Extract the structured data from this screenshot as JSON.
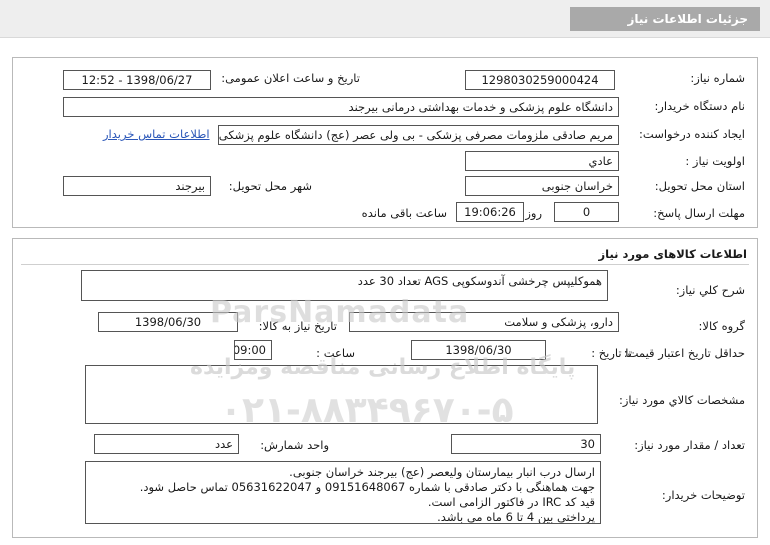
{
  "window": {
    "title": "جزئیات اطلاعات نیاز"
  },
  "info": {
    "need_number_label": "شماره نیاز:",
    "need_number": "1298030259000424",
    "announce_datetime_label": "تاریخ و ساعت اعلان عمومی:",
    "announce_datetime": "1398/06/27 - 12:52",
    "buyer_org_label": "نام دستگاه خریدار:",
    "buyer_org": "دانشگاه علوم پزشکی و خدمات بهداشتی درمانی بیرجند",
    "requester_label": "ایجاد کننده درخواست:",
    "requester": "مریم صادقی ملزومات مصرفی پزشکی - بی ولی عصر (عج) دانشگاه علوم پزشکی",
    "contact_link": "اطلاعات تماس خریدار",
    "priority_label": "اولویت نیاز :",
    "priority": "عادي",
    "province_label": "استان محل تحویل:",
    "province": "خراسان جنوبی",
    "city_label": "شهر محل تحویل:",
    "city": "بیرجند",
    "deadline_label": "مهلت ارسال پاسخ:",
    "deadline_days": "0",
    "deadline_days_suffix": "روز و",
    "deadline_time": "19:06:26",
    "deadline_remaining": "ساعت باقی مانده"
  },
  "goods": {
    "section_title": "اطلاعات کالاهای مورد نیاز",
    "general_desc_label": "شرح کلي نياز:",
    "general_desc": "هموکلیپس چرخشی آندوسکوپی AGS تعداد 30 عدد",
    "group_label": "گروه کالا:",
    "group": "دارو، پزشکی و سلامت",
    "need_date_label": "تاریخ نیاز به کالا:",
    "need_date": "1398/06/30",
    "validity_label": "حداقل تاریخ اعتبار قیمت:",
    "validity_until_label": "تا تاریخ :",
    "validity_date": "1398/06/30",
    "validity_time_label": "ساعت :",
    "validity_time": "09:00",
    "specs_label": "مشخصات کالاي مورد نياز:",
    "specs": "",
    "quantity_label": "تعداد / مقدار مورد نیاز:",
    "quantity": "30",
    "unit_label": "واحد شمارش:",
    "unit": "عدد",
    "buyer_notes_label": "توضیحات خریدار:",
    "buyer_notes": [
      "ارسال درب انبار بیمارستان ولیعصر (عج) بیرجند خراسان جنوبی.",
      "جهت هماهنگی با دکتر صادقی با شماره 09151648067 و 05631622047 تماس حاصل شود.",
      "قید کد IRC در فاکتور الزامی است.",
      "پرداختی بین 4 تا 6 ماه می باشد."
    ]
  },
  "watermark": {
    "line1": "پایگاه اطلاع رسانی مناقصه ومزایده",
    "line2": "۰۲۱-۸۸۳۴۹۶۷۰-۵",
    "brand": "ParsNamadata"
  },
  "colors": {
    "title_bg": "#a9a9a9",
    "link": "#2a56b8",
    "border": "#555555"
  }
}
